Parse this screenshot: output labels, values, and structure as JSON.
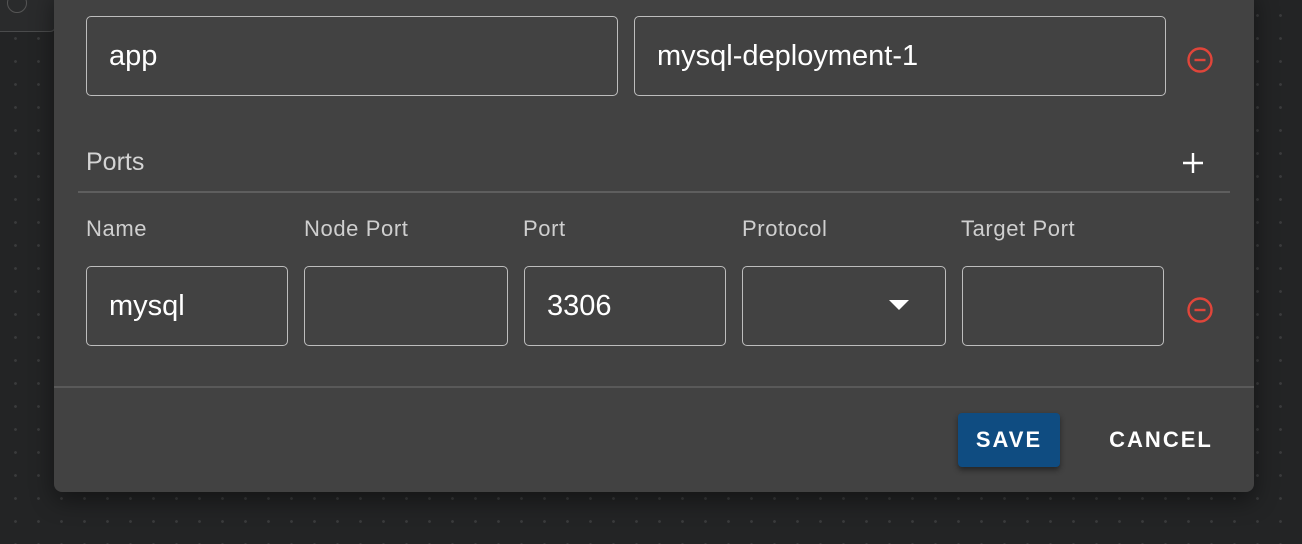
{
  "labels_row": {
    "key_value": "app",
    "value_value": "mysql-deployment-1"
  },
  "ports": {
    "title": "Ports",
    "columns": {
      "name": "Name",
      "node_port": "Node Port",
      "port": "Port",
      "protocol": "Protocol",
      "target_port": "Target Port"
    },
    "rows": [
      {
        "name": "mysql",
        "node_port": "",
        "port": "3306",
        "protocol": "",
        "target_port": ""
      }
    ]
  },
  "actions": {
    "save_label": "SAVE",
    "cancel_label": "CANCEL"
  },
  "icons": {
    "remove": "remove-circle-icon",
    "add": "plus-icon",
    "dropdown": "dropdown-arrow-icon"
  },
  "colors": {
    "dialog_bg": "#424242",
    "page_bg": "#232425",
    "remove_icon": "#e0453a",
    "save_button": "#0f4c81",
    "field_border": "#bdbdbd"
  }
}
